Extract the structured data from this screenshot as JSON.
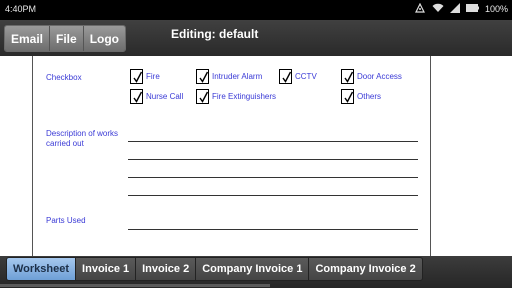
{
  "status_bar": {
    "time": "4:40PM",
    "battery": "100%",
    "icons": [
      "usb-debug-icon",
      "wifi-icon",
      "signal-icon",
      "battery-icon"
    ]
  },
  "action_bar": {
    "menu": [
      {
        "id": "email",
        "label": "Email"
      },
      {
        "id": "file",
        "label": "File"
      },
      {
        "id": "logo",
        "label": "Logo"
      }
    ],
    "title": "Editing: default"
  },
  "form": {
    "checkbox_label": "Checkbox",
    "checkboxes": [
      {
        "label": "Fire",
        "checked": true
      },
      {
        "label": "Intruder Alarm",
        "checked": true
      },
      {
        "label": "CCTV",
        "checked": true
      },
      {
        "label": "Door Access",
        "checked": true
      },
      {
        "label": "Nurse Call",
        "checked": true
      },
      {
        "label": "Fire Extinguishers",
        "checked": true
      },
      {
        "label": "Others",
        "checked": true
      }
    ],
    "description_label": "Description of works carried out",
    "parts_used_label": "Parts Used"
  },
  "tabs": [
    {
      "label": "Worksheet",
      "active": true
    },
    {
      "label": "Invoice 1",
      "active": false
    },
    {
      "label": "Invoice 2",
      "active": false
    },
    {
      "label": "Company Invoice 1",
      "active": false
    },
    {
      "label": "Company Invoice 2",
      "active": false
    }
  ],
  "colors": {
    "label_blue": "#3a3ad6",
    "active_tab": "#6e9fd6"
  }
}
